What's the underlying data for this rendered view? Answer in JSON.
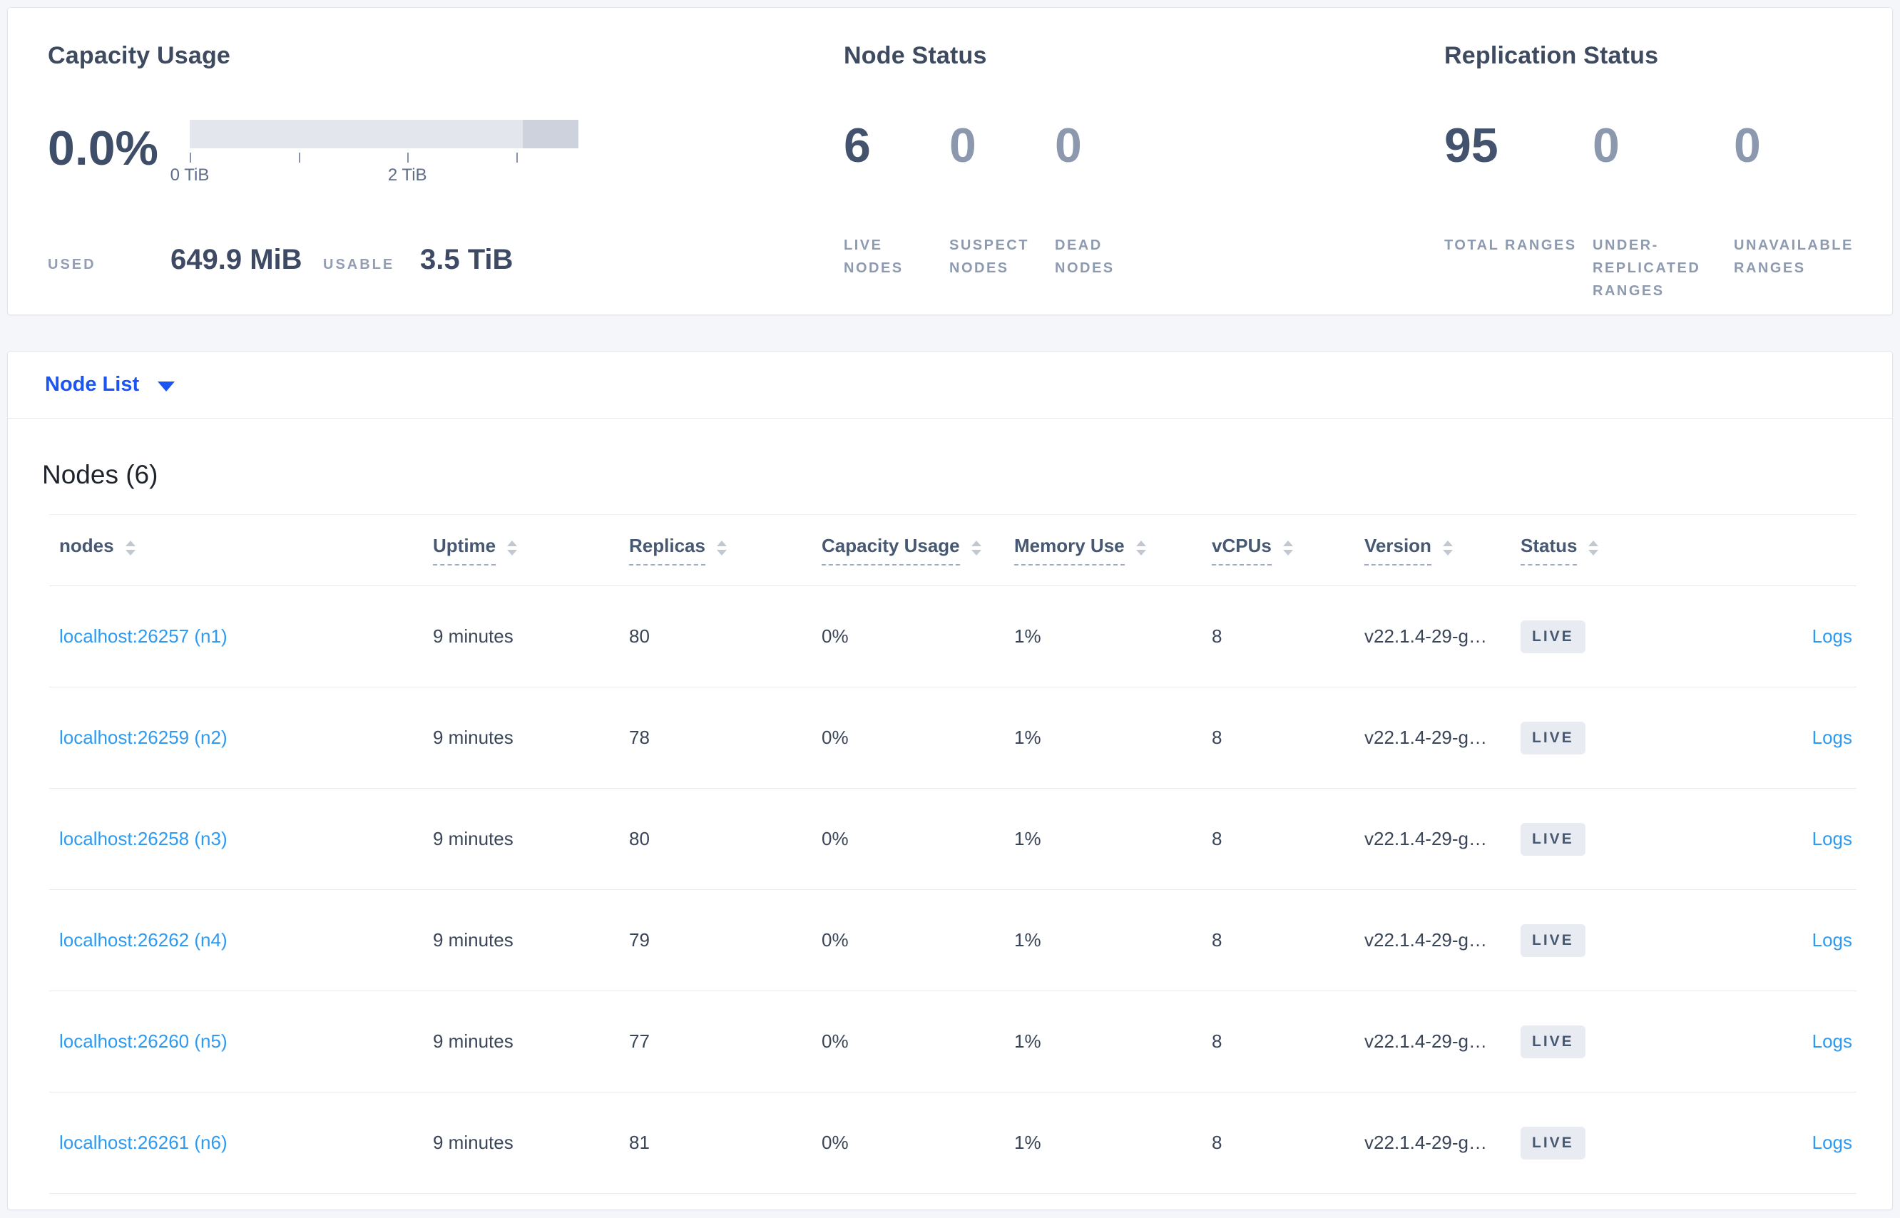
{
  "colors": {
    "accent_link": "#2e9af2",
    "selector_link": "#1b55f2",
    "badge_bg": "#e8ebf2",
    "badge_text": "#475872",
    "bar_light": "#e3e6ec",
    "bar_dark": "#cdd2dc"
  },
  "summary": {
    "capacity": {
      "title": "Capacity Usage",
      "percent": "0.0%",
      "tick_labels": [
        "0 TiB",
        "2 TiB"
      ],
      "used_label": "USED",
      "used_value": "649.9 MiB",
      "usable_label": "USABLE",
      "usable_value": "3.5 TiB"
    },
    "node_status": {
      "title": "Node Status",
      "stats": [
        {
          "value": "6",
          "label": "LIVE NODES"
        },
        {
          "value": "0",
          "label": "SUSPECT NODES"
        },
        {
          "value": "0",
          "label": "DEAD NODES"
        }
      ]
    },
    "replication_status": {
      "title": "Replication Status",
      "stats": [
        {
          "value": "95",
          "label": "TOTAL RANGES"
        },
        {
          "value": "0",
          "label": "UNDER-REPLICATED RANGES"
        },
        {
          "value": "0",
          "label": "UNAVAILABLE RANGES"
        }
      ]
    }
  },
  "view_selector": {
    "label": "Node List",
    "icon": "caret-down-icon"
  },
  "nodes_panel": {
    "title": "Nodes (6)",
    "columns": [
      {
        "label": "nodes",
        "sortable": true,
        "dashed_underline": false
      },
      {
        "label": "Uptime",
        "sortable": true,
        "dashed_underline": true
      },
      {
        "label": "Replicas",
        "sortable": true,
        "dashed_underline": true
      },
      {
        "label": "Capacity Usage",
        "sortable": true,
        "dashed_underline": true
      },
      {
        "label": "Memory Use",
        "sortable": true,
        "dashed_underline": true
      },
      {
        "label": "vCPUs",
        "sortable": true,
        "dashed_underline": true
      },
      {
        "label": "Version",
        "sortable": true,
        "dashed_underline": true
      },
      {
        "label": "Status",
        "sortable": true,
        "dashed_underline": true
      }
    ],
    "rows": [
      {
        "address": "localhost:26257 (n1)",
        "uptime": "9 minutes",
        "replicas": "80",
        "capacity_usage": "0%",
        "memory_use": "1%",
        "vcpus": "8",
        "version": "v22.1.4-29-g…",
        "status": "LIVE",
        "logs": "Logs"
      },
      {
        "address": "localhost:26259 (n2)",
        "uptime": "9 minutes",
        "replicas": "78",
        "capacity_usage": "0%",
        "memory_use": "1%",
        "vcpus": "8",
        "version": "v22.1.4-29-g…",
        "status": "LIVE",
        "logs": "Logs"
      },
      {
        "address": "localhost:26258 (n3)",
        "uptime": "9 minutes",
        "replicas": "80",
        "capacity_usage": "0%",
        "memory_use": "1%",
        "vcpus": "8",
        "version": "v22.1.4-29-g…",
        "status": "LIVE",
        "logs": "Logs"
      },
      {
        "address": "localhost:26262 (n4)",
        "uptime": "9 minutes",
        "replicas": "79",
        "capacity_usage": "0%",
        "memory_use": "1%",
        "vcpus": "8",
        "version": "v22.1.4-29-g…",
        "status": "LIVE",
        "logs": "Logs"
      },
      {
        "address": "localhost:26260 (n5)",
        "uptime": "9 minutes",
        "replicas": "77",
        "capacity_usage": "0%",
        "memory_use": "1%",
        "vcpus": "8",
        "version": "v22.1.4-29-g…",
        "status": "LIVE",
        "logs": "Logs"
      },
      {
        "address": "localhost:26261 (n6)",
        "uptime": "9 minutes",
        "replicas": "81",
        "capacity_usage": "0%",
        "memory_use": "1%",
        "vcpus": "8",
        "version": "v22.1.4-29-g…",
        "status": "LIVE",
        "logs": "Logs"
      }
    ]
  }
}
